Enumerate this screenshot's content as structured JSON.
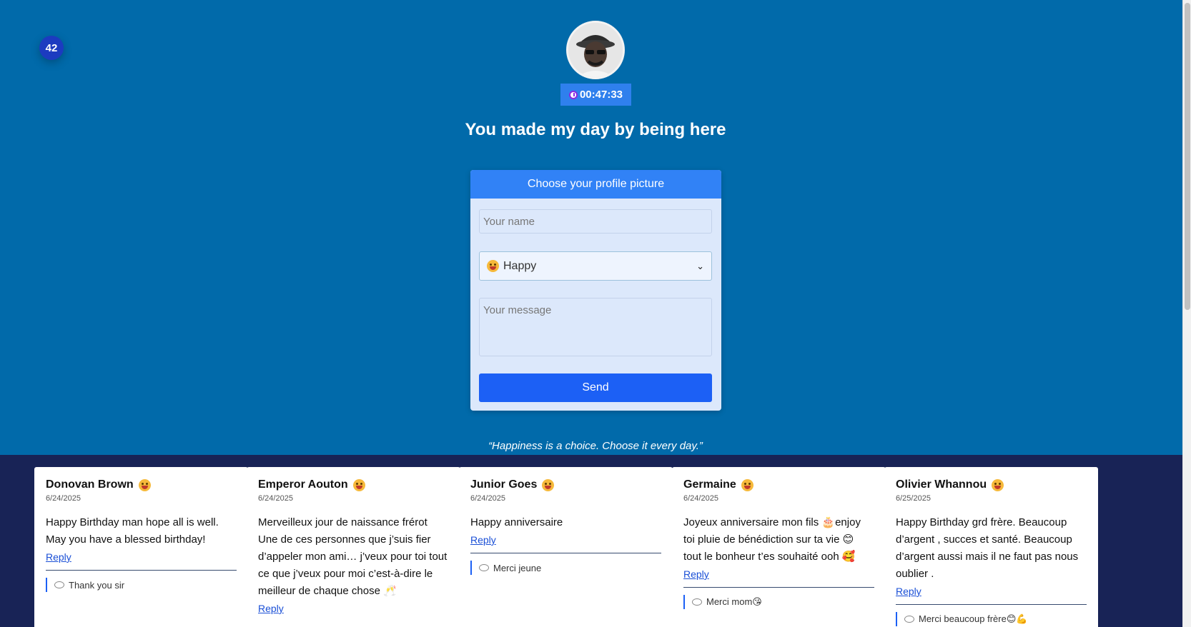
{
  "counter": "42",
  "timer": "00:47:33",
  "headline": "You made my day by being here",
  "form": {
    "choose_picture_label": "Choose your profile picture",
    "name_placeholder": "Your name",
    "mood_selected": "Happy",
    "message_placeholder": "Your message",
    "send_label": "Send"
  },
  "quote": "“Happiness is a choice. Choose it every day.”",
  "messages": [
    {
      "name": "Donovan Brown",
      "date": "6/24/2025",
      "text": "Happy Birthday man hope all is well. May you have a blessed birthday!",
      "reply_label": "Reply",
      "response": "Thank you sir"
    },
    {
      "name": "Emperor Aouton",
      "date": "6/24/2025",
      "text": "Merveilleux jour de naissance frérot Une de ces personnes que j’suis fier d’appeler mon ami… j’veux pour toi tout ce que j’veux pour moi c’est-à-dire le meilleur de chaque chose 🥂",
      "reply_label": "Reply",
      "response": ""
    },
    {
      "name": "Junior Goes",
      "date": "6/24/2025",
      "text": "Happy anniversaire",
      "reply_label": "Reply",
      "response": "Merci jeune"
    },
    {
      "name": "Germaine",
      "date": "6/24/2025",
      "text": "Joyeux anniversaire mon fils 🎂enjoy toi pluie de bénédiction sur ta vie 😊 tout le bonheur t’es souhaité ooh 🥰",
      "reply_label": "Reply",
      "response": "Merci mom😘"
    },
    {
      "name": "Olivier Whannou",
      "date": "6/25/2025",
      "text": "Happy Birthday grd frère. Beaucoup d’argent , succes et santé. Beaucoup d’argent aussi mais il ne faut pas nous oublier .",
      "reply_label": "Reply",
      "response": "Merci beaucoup frère😊💪"
    }
  ]
}
